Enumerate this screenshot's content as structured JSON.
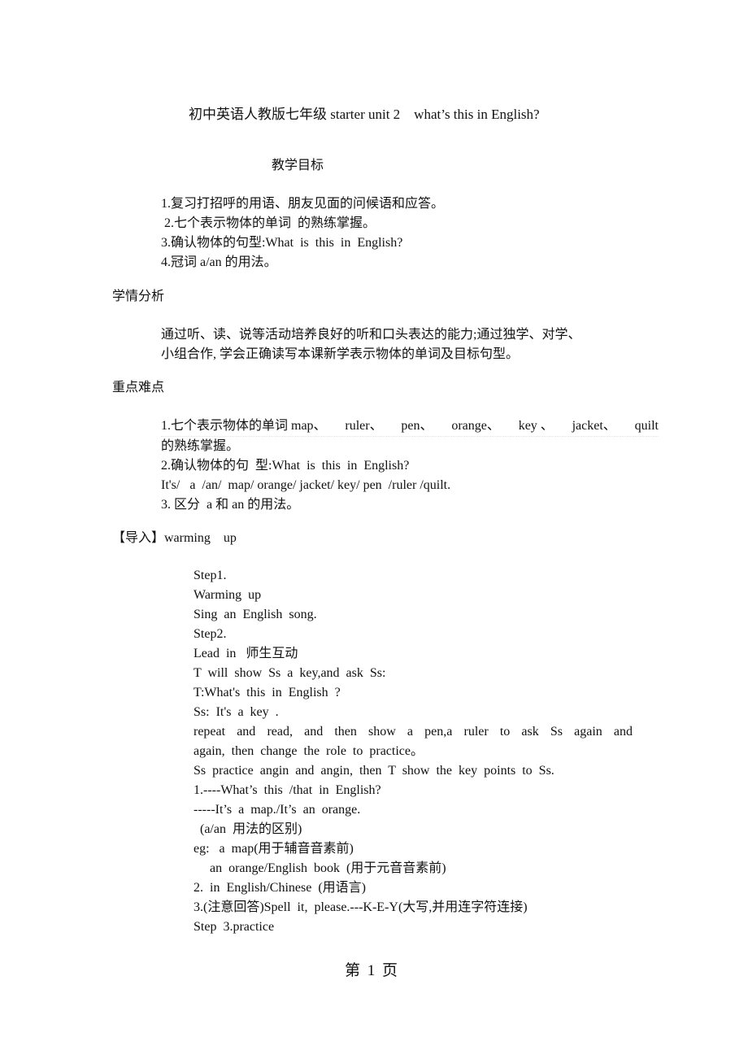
{
  "document": {
    "title": "初中英语人教版七年级 starter unit 2    what’s this in English?",
    "sections": {
      "goals": {
        "heading": "教学目标",
        "items": [
          "1.复习打招呼的用语、朋友见面的问候语和应答。",
          " 2.七个表示物体的单词  的熟练掌握。",
          "3.确认物体的句型:What  is  this  in  English?",
          "4.冠词 a/an 的用法。"
        ]
      },
      "analysis": {
        "heading": "学情分析",
        "lines": [
          "通过听、读、说等活动培养良好的听和口头表达的能力;通过独学、对学、",
          "小组合作, 学会正确读写本课新学表示物体的单词及目标句型。"
        ]
      },
      "keypoints": {
        "heading": "重点难点",
        "line1_parts": [
          "1.七个表示物体的单词 map、",
          "ruler、",
          "pen、",
          "orange、",
          "key 、",
          "jacket、",
          "quilt"
        ],
        "lines": [
          "的熟练掌握。",
          "2.确认物体的句  型:What  is  this  in  English?",
          "It's/   a  /an/  map/ orange/ jacket/ key/ pen  /ruler /quilt.",
          "3. 区分  a 和 an 的用法。"
        ]
      },
      "intro": {
        "heading": "【导入】warming    up",
        "lines": [
          "Step1.",
          "Warming  up",
          "Sing  an  English  song.",
          "Step2.",
          "Lead  in   师生互动",
          "T  will  show  Ss  a  key,and  ask  Ss:",
          "T:What's  this  in  English  ?",
          "Ss:  It's  a  key  .",
          "repeat and read, and then show a pen,a ruler to ask Ss again and",
          "again,  then  change  the  role  to  practice。",
          "Ss  practice  angin  and  angin,  then  T  show  the  key  points  to  Ss.",
          "1.----What’s  this  /that  in  English?",
          "-----It’s  a  map./It’s  an  orange.",
          "  (a/an  用法的区别)",
          "eg:   a  map(用于辅音音素前)",
          "     an  orange/English  book  (用于元音音素前)",
          "2.  in  English/Chinese  (用语言)",
          "3.(注意回答)Spell  it,  please.---K-E-Y(大写,并用连字符连接)",
          "Step  3.practice"
        ]
      }
    },
    "footer": {
      "page_label": "第 1 页"
    }
  }
}
